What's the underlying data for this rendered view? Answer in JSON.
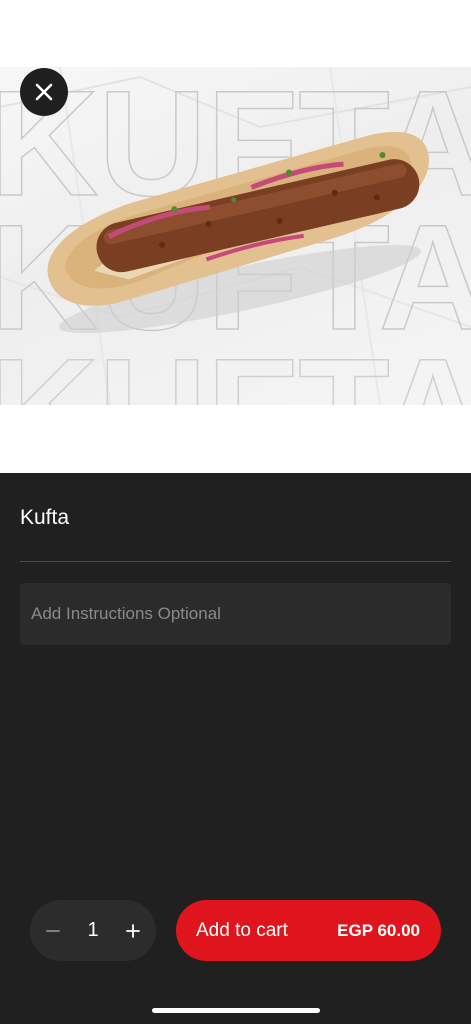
{
  "product": {
    "name": "Kufta",
    "image_alt": "Kufta sandwich",
    "image_watermark": "KUFTA"
  },
  "instructions": {
    "placeholder": "Add Instructions Optional",
    "value": ""
  },
  "quantity": {
    "value": "1"
  },
  "cart_button": {
    "label": "Add to cart",
    "price": "EGP 60.00"
  },
  "colors": {
    "sheet_background": "#202020",
    "accent": "#e0141c",
    "input_background": "#2b2b2b",
    "stepper_background": "#2c2c2c"
  },
  "icons": {
    "close": "close-icon",
    "minus": "minus-icon",
    "plus": "plus-icon"
  }
}
